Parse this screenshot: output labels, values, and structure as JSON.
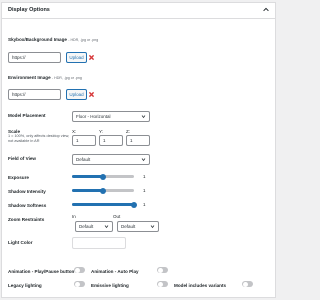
{
  "panel": {
    "title": "Display Options"
  },
  "skybox": {
    "label": "Skybox/Background Image",
    "note": "- HDR, .jpg or .png",
    "value": "https://",
    "upload_label": "Upload"
  },
  "environment": {
    "label": "Environment Image",
    "note": "- HDR, .jpg or .png",
    "value": "https://",
    "upload_label": "Upload"
  },
  "placement": {
    "label": "Model Placement",
    "selected": "Floor - Horizontal"
  },
  "scale": {
    "label": "Scale",
    "note": "1 = 100%, only affects desktop view, not available in AR",
    "x_label": "X:",
    "x_value": "1",
    "y_label": "Y:",
    "y_value": "1",
    "z_label": "Z:",
    "z_value": "1"
  },
  "field_of_view": {
    "label": "Field of View",
    "selected": "Default"
  },
  "exposure": {
    "label": "Exposure",
    "value": "1",
    "fraction": 0.5
  },
  "shadow_intensity": {
    "label": "Shadow Intensity",
    "value": "1",
    "fraction": 0.5
  },
  "shadow_softness": {
    "label": "Shadow Softness",
    "value": "1",
    "fraction": 1.0
  },
  "zoom": {
    "label": "Zoom Restraints",
    "in_label": "In",
    "in_selected": "Default",
    "out_label": "Out",
    "out_selected": "Default"
  },
  "light_color": {
    "label": "Light Color"
  },
  "toggles": {
    "play_pause": "Animation - Play/Pause button",
    "auto_play": "Animation - Auto Play",
    "legacy_lighting": "Legacy lighting",
    "emissive_lighting": "Emissive lighting",
    "model_variants": "Model includes variants"
  },
  "colors": {
    "accent": "#2271b1",
    "danger": "#d63638",
    "toggle_off": "#c3c4c7"
  }
}
